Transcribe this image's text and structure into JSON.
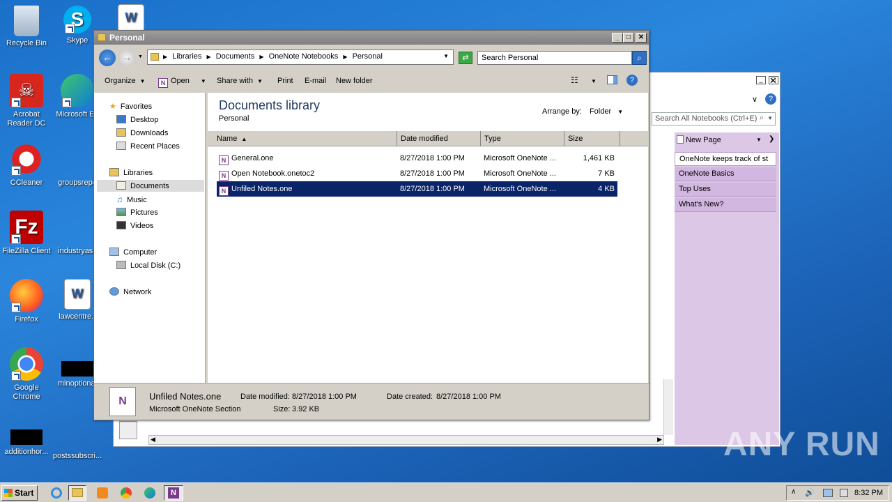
{
  "desktop": {
    "icons": [
      {
        "label": "Recycle Bin"
      },
      {
        "label": "Skype"
      },
      {
        "label": "Acrobat Reader DC"
      },
      {
        "label": "Microsoft Ed"
      },
      {
        "label": "CCleaner"
      },
      {
        "label": "groupsrepo"
      },
      {
        "label": "FileZilla Client"
      },
      {
        "label": "industryask"
      },
      {
        "label": "Firefox"
      },
      {
        "label": "lawcentre.r"
      },
      {
        "label": "Google Chrome"
      },
      {
        "label": "minoptional"
      },
      {
        "label": "additionhor..."
      },
      {
        "label": "postssubscri..."
      }
    ]
  },
  "onenote": {
    "search_placeholder": "Search All Notebooks (Ctrl+E)",
    "new_page": "New Page",
    "pages": [
      "OneNote keeps track of st",
      "OneNote Basics",
      "Top Uses",
      "What's New?"
    ]
  },
  "explorer": {
    "title": "Personal",
    "breadcrumb": [
      "Libraries",
      "Documents",
      "OneNote Notebooks",
      "Personal"
    ],
    "search_placeholder": "Search Personal",
    "toolbar": {
      "organize": "Organize",
      "open": "Open",
      "share_with": "Share with",
      "print": "Print",
      "email": "E-mail",
      "new_folder": "New folder"
    },
    "nav": {
      "favorites": "Favorites",
      "desktop": "Desktop",
      "downloads": "Downloads",
      "recent": "Recent Places",
      "libraries": "Libraries",
      "documents": "Documents",
      "music": "Music",
      "pictures": "Pictures",
      "videos": "Videos",
      "computer": "Computer",
      "local_disk": "Local Disk (C:)",
      "network": "Network"
    },
    "library_title": "Documents library",
    "library_subtitle": "Personal",
    "arrange_by_label": "Arrange by:",
    "arrange_by_value": "Folder",
    "columns": {
      "name": "Name",
      "date": "Date modified",
      "type": "Type",
      "size": "Size"
    },
    "files": [
      {
        "name": "General.one",
        "date": "8/27/2018 1:00 PM",
        "type": "Microsoft OneNote ...",
        "size": "1,461 KB"
      },
      {
        "name": "Open Notebook.onetoc2",
        "date": "8/27/2018 1:00 PM",
        "type": "Microsoft OneNote ...",
        "size": "7 KB"
      },
      {
        "name": "Unfiled Notes.one",
        "date": "8/27/2018 1:00 PM",
        "type": "Microsoft OneNote ...",
        "size": "4 KB"
      }
    ],
    "details": {
      "name": "Unfiled Notes.one",
      "kind": "Microsoft OneNote Section",
      "date_modified_label": "Date modified:",
      "date_modified": "8/27/2018 1:00 PM",
      "date_created_label": "Date created:",
      "date_created": "8/27/2018 1:00 PM",
      "size_label": "Size:",
      "size": "3.92 KB"
    }
  },
  "taskbar": {
    "start": "Start",
    "clock": "8:32 PM"
  },
  "watermark": "ANY RUN"
}
